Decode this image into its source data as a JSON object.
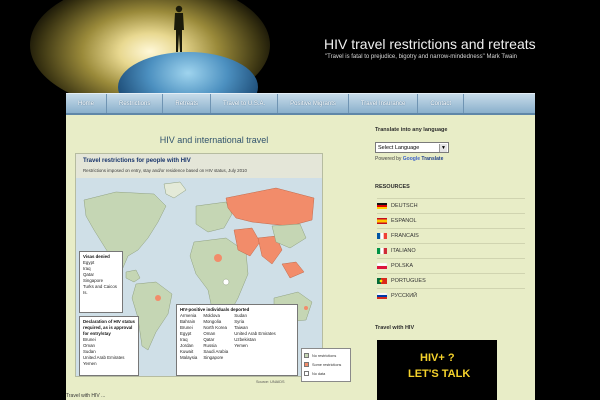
{
  "site": {
    "title": "HIV travel restrictions and retreats",
    "tagline": "\"Travel is fatal to prejudice, bigotry and narrow-mindedness\" Mark Twain"
  },
  "nav": {
    "items": [
      {
        "label": "Home"
      },
      {
        "label": "Restrictions"
      },
      {
        "label": "Retreats"
      },
      {
        "label": "Travel to U.S.A."
      },
      {
        "label": "Positive Migrants"
      },
      {
        "label": "Travel Insurance"
      },
      {
        "label": "Contact"
      }
    ]
  },
  "post": {
    "title": "HIV and international travel",
    "body": "Travel with HIV ..."
  },
  "map": {
    "title": "Travel restrictions for people with HIV",
    "subtitle": "Restrictions imposed on entry, stay and/or residence based on HIV status, July 2010",
    "visas_denied": {
      "title": "Visas denied",
      "countries": [
        "Egypt",
        "Iraq",
        "Qatar",
        "Singapore",
        "Turks and Caicos Is."
      ]
    },
    "declaration": {
      "title": "Declaration of HIV status required, as is approval for entry/stay",
      "countries": [
        "Brunei",
        "Oman",
        "Sudan",
        "United Arab Emirates",
        "Yemen"
      ]
    },
    "deported": {
      "title": "HIV-positive individuals deported",
      "col1": [
        "Armenia",
        "Bahrain",
        "Brunei",
        "Egypt",
        "Iraq",
        "Jordan",
        "Kuwait",
        "Malaysia"
      ],
      "col2": [
        "Moldova",
        "Mongolia",
        "North Korea",
        "Oman",
        "Qatar",
        "Russia",
        "Saudi Arabia",
        "Singapore"
      ],
      "col3": [
        "Sudan",
        "Syria",
        "Taiwan",
        "United Arab Emirates",
        "Uzbekistan",
        "Yemen"
      ]
    },
    "legend": {
      "items": [
        {
          "label": "No restrictions",
          "color": "#c5d6b4"
        },
        {
          "label": "Some restrictions",
          "color": "#f28c6a"
        },
        {
          "label": "No data",
          "color": "#ffffff"
        }
      ],
      "source": "Source: UNAIDS"
    }
  },
  "sidebar": {
    "translate_heading": "Translate into any language",
    "select_value": "Select Language",
    "powered_by": "Powered by",
    "google": "Google",
    "translate": "Translate",
    "resources_heading": "RESOURCES",
    "resources": [
      {
        "label": "DEUTSCH"
      },
      {
        "label": "ESPANOL"
      },
      {
        "label": "FRANCAIS"
      },
      {
        "label": "ITALIANO"
      },
      {
        "label": "POLSKA"
      },
      {
        "label": "PORTUGUES"
      },
      {
        "label": "РУССКИЙ"
      }
    ],
    "video_heading": "Travel with HIV",
    "video_line1": "HIV+ ?",
    "video_line2": "LET'S TALK"
  }
}
